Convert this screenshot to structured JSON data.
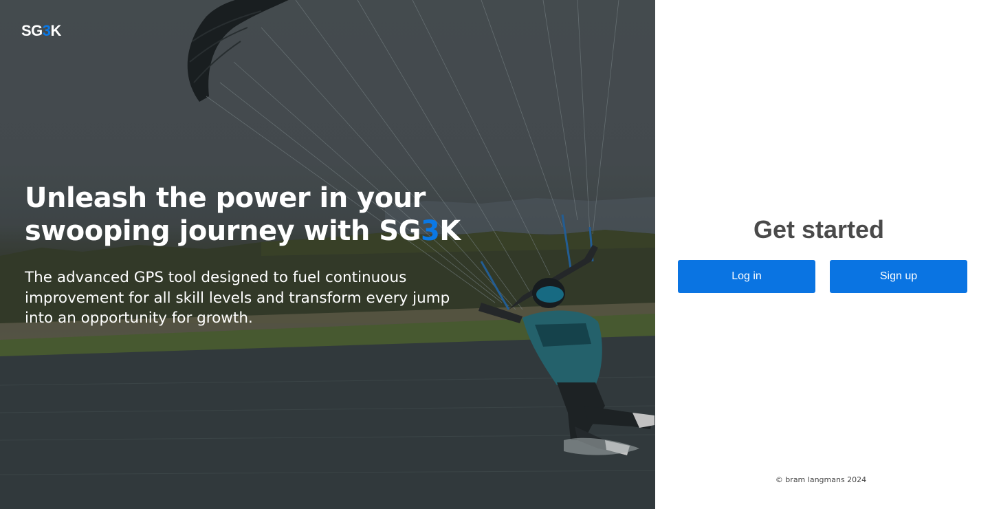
{
  "brand": {
    "prefix": "SG",
    "accent": "3",
    "suffix": "K",
    "accent_color": "#0a78e6"
  },
  "hero": {
    "headline_part1": "Unleash the power in your swooping journey with SG",
    "headline_accent": "3",
    "headline_part2": "K",
    "tagline": "The advanced GPS tool designed to fuel continuous\nimprovement for all skill levels and transform every jump\n into an opportunity for growth."
  },
  "panel": {
    "title": "Get started",
    "login_label": "Log in",
    "signup_label": "Sign up",
    "button_color": "#0a74e2",
    "copyright": "© bram langmans 2024"
  }
}
